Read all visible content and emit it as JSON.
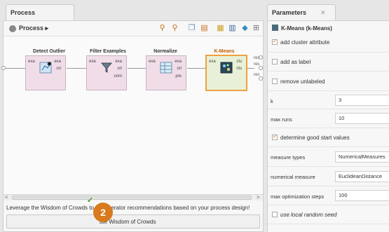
{
  "process_panel": {
    "tab_title": "Process",
    "breadcrumb": "Process ▸",
    "operators": [
      {
        "title": "Detect Outlier",
        "in_ports": [
          "exa"
        ],
        "out_ports": [
          "exa",
          "ori"
        ]
      },
      {
        "title": "Filter Examples",
        "in_ports": [
          "exa"
        ],
        "out_ports": [
          "exa",
          "ori",
          "unm"
        ]
      },
      {
        "title": "Normalize",
        "in_ports": [
          "exa"
        ],
        "out_ports": [
          "exa",
          "ori",
          "pre"
        ]
      },
      {
        "title": "K-Means",
        "in_ports": [
          "exa"
        ],
        "out_ports": [
          "clu",
          "clu"
        ]
      }
    ],
    "result_ports": [
      "res",
      "res",
      "res"
    ],
    "wisdom_text": "Leverage the Wisdom of Crowds to get operator recommendations based on your process design!",
    "wisdom_button": "ate Wisdom of Crowds",
    "step_badge": "2"
  },
  "parameters_panel": {
    "tab_title": "Parameters",
    "operator_header": "K-Means (k-Means)",
    "checkboxes": [
      {
        "label": "add cluster attribute",
        "checked": true
      },
      {
        "label": "add as label",
        "checked": false
      },
      {
        "label": "remove unlabeled",
        "checked": false
      }
    ],
    "fields": [
      {
        "label": "k",
        "value": "3"
      },
      {
        "label": "max runs",
        "value": "10"
      }
    ],
    "good_start": {
      "label": "determine good start values",
      "checked": true
    },
    "fields2": [
      {
        "label": "measure types",
        "value": "NumericalMeasures"
      },
      {
        "label": "numerical measure",
        "value": "EuclideanDistance"
      },
      {
        "label": "max optimization steps",
        "value": "100"
      }
    ],
    "local_seed": {
      "label": "use local random seed",
      "checked": false
    }
  },
  "colors": {
    "accent": "#d87a1e",
    "operator_fill": "#f1dde8",
    "selected_fill": "#e8f1d8"
  }
}
